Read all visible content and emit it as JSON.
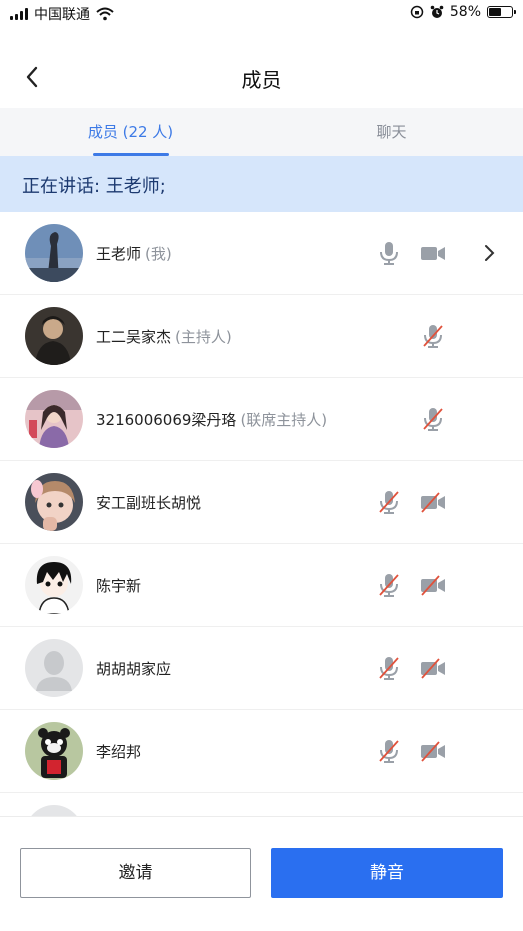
{
  "status_bar": {
    "carrier": "中国联通",
    "battery": "58%",
    "battery_level": 0.58
  },
  "header": {
    "title": "成员"
  },
  "tabs": [
    {
      "label": "成员 (22 人)",
      "active": true
    },
    {
      "label": "聊天",
      "active": false
    }
  ],
  "speaking_banner": "正在讲话: 王老师;",
  "members": [
    {
      "name": "王老师",
      "role": "(我)",
      "mic": "on",
      "camera": "on",
      "has_arrow": true,
      "avatar_icon": "photo-avatar"
    },
    {
      "name": "工二吴家杰",
      "role": "(主持人)",
      "mic": "muted",
      "camera": "none",
      "avatar_icon": "photo-avatar"
    },
    {
      "name": "3216006069梁丹珞",
      "role": "(联席主持人)",
      "mic": "muted",
      "camera": "none",
      "avatar_icon": "photo-avatar"
    },
    {
      "name": "安工副班长胡悦",
      "role": "",
      "mic": "muted",
      "camera": "off",
      "avatar_icon": "photo-avatar"
    },
    {
      "name": "陈宇新",
      "role": "",
      "mic": "muted",
      "camera": "off",
      "avatar_icon": "photo-avatar"
    },
    {
      "name": "胡胡胡家应",
      "role": "",
      "mic": "muted",
      "camera": "off",
      "avatar_icon": "default-avatar"
    },
    {
      "name": "李绍邦",
      "role": "",
      "mic": "muted",
      "camera": "off",
      "avatar_icon": "photo-avatar"
    }
  ],
  "buttons": {
    "invite": "邀请",
    "mute": "静音"
  },
  "colors": {
    "accent": "#2a6ff0",
    "tab_active": "#3d7ae6",
    "banner_bg": "#d6e6fb",
    "muted_slash": "#e0523c"
  }
}
